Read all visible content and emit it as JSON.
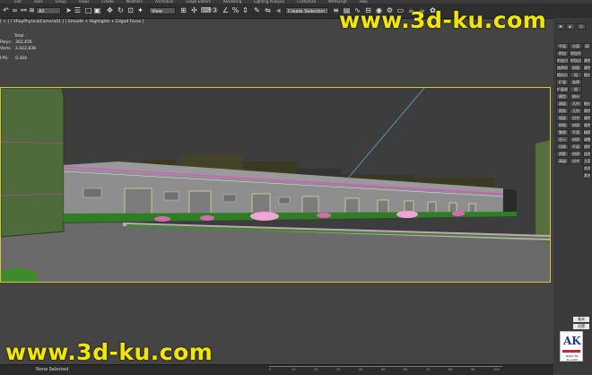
{
  "menubar": {
    "items": [
      "Edit",
      "Tools",
      "Group",
      "Views",
      "Create",
      "Modifiers",
      "Animation",
      "Graph Editors",
      "Rendering",
      "Lighting Analysis",
      "Customize",
      "MAXScript",
      "Help"
    ]
  },
  "toolbar": {
    "selection_filter": "All",
    "reference_coord": "View",
    "named_selection_set": "Create Selection Set"
  },
  "viewport": {
    "label": "[ + ] [ VRayPhysicalCamera01 ] [ Smooth + Highlights + Edged Faces ]",
    "stats": {
      "header": "Total",
      "polys_label": "Polys:",
      "polys_value": "302,456",
      "verts_label": "Verts:",
      "verts_value": "2,422,838",
      "fps_label": "FPS:",
      "fps_value": "0.304"
    },
    "border_color": "#d6c63a"
  },
  "command_panel": {
    "buttons": [
      [
        "平面",
        "分离",
        "网"
      ],
      [
        "附加",
        "附加列表",
        ""
      ],
      [
        "附加/边",
        "附加边",
        "属性"
      ],
      [
        "选择/网格",
        "网格",
        "属性"
      ],
      [
        "随机分割",
        "组",
        "细分"
      ],
      [
        "扩展",
        "选择",
        ""
      ],
      [
        "扩展选择",
        "组",
        ""
      ],
      [
        "模型",
        "统计",
        ""
      ],
      [
        "超级",
        "几何",
        "细分"
      ],
      [
        "倒角",
        "几何",
        "属性"
      ],
      [
        "镜面",
        "对齐",
        "属性"
      ],
      [
        "网格",
        "材质",
        "属性"
      ],
      [
        "整理",
        "平滑",
        "精简"
      ],
      [
        "显示",
        "材质",
        "调整"
      ],
      [
        "切换",
        "平面",
        "透明"
      ],
      [
        "阴影",
        "材质",
        "组合"
      ],
      [
        "高级",
        "对齐",
        "主菜"
      ],
      [
        "",
        "",
        "合并"
      ],
      [
        "",
        "",
        "其它"
      ]
    ],
    "unit_select": "毫米",
    "bottom_select": "设置"
  },
  "logo": {
    "letters": "AK",
    "subtitle": "www.3d-ku.com"
  },
  "statusbar": {
    "selection": "None Selected",
    "ruler_ticks": [
      "0",
      "10",
      "20",
      "30",
      "40",
      "50",
      "60",
      "70",
      "80",
      "90",
      "100"
    ]
  },
  "watermark": {
    "top": "www.3d-ku.com",
    "bottom": "www.3d-ku.com",
    "color": "#f3e600"
  },
  "scene": {
    "ground_color": "#6a6a6a",
    "building_color": "#8e8e8e",
    "roof_edge_color": "#e64bd0",
    "flower_color": "#f0a5d6",
    "hedge_color": "#2f7d24"
  }
}
